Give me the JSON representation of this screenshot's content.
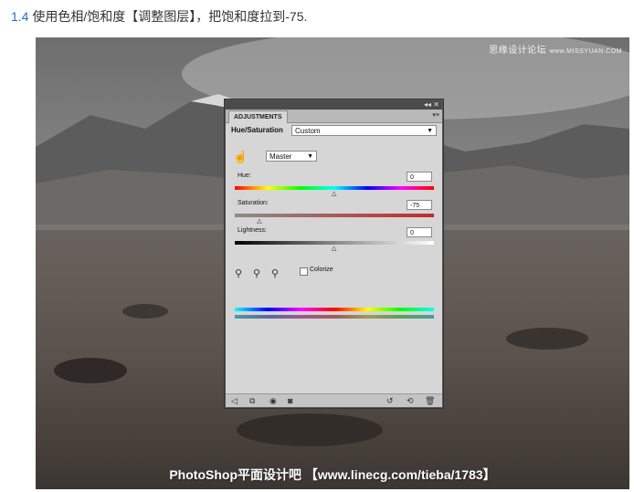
{
  "caption": {
    "number": "1.4",
    "text": "使用色相/饱和度【调整图层】，把饱和度拉到-75."
  },
  "watermark_top": {
    "main": "思缘设计论坛",
    "url": "www.MISSYUAN.COM"
  },
  "watermark_bottom": "PhotoShop平面设计吧 【www.linecg.com/tieba/1783】",
  "panel": {
    "title_controls": "◂◂ ✕",
    "tab": "ADJUSTMENTS",
    "menu_icon": "▾≡",
    "heading": "Hue/Saturation",
    "preset": "Custom",
    "channel": "Master",
    "hue": {
      "label": "Hue:",
      "value": "0",
      "level": 0.5
    },
    "saturation": {
      "label": "Saturation:",
      "value": "-75",
      "level": 0.125
    },
    "lightness": {
      "label": "Lightness:",
      "value": "0",
      "level": 0.5
    },
    "colorize": {
      "label": "Colorize",
      "checked": false
    },
    "colors": {
      "panel_bg": "#d6d6d6",
      "titlebar": "#4b4b4b"
    },
    "icons": [
      "hand-adjust-icon",
      "eyedropper-icon",
      "eyedropper-plus-icon",
      "eyedropper-minus-icon",
      "back-icon",
      "clip-icon",
      "visibility-icon",
      "view-previous-icon",
      "reset-icon",
      "delete-icon"
    ]
  }
}
